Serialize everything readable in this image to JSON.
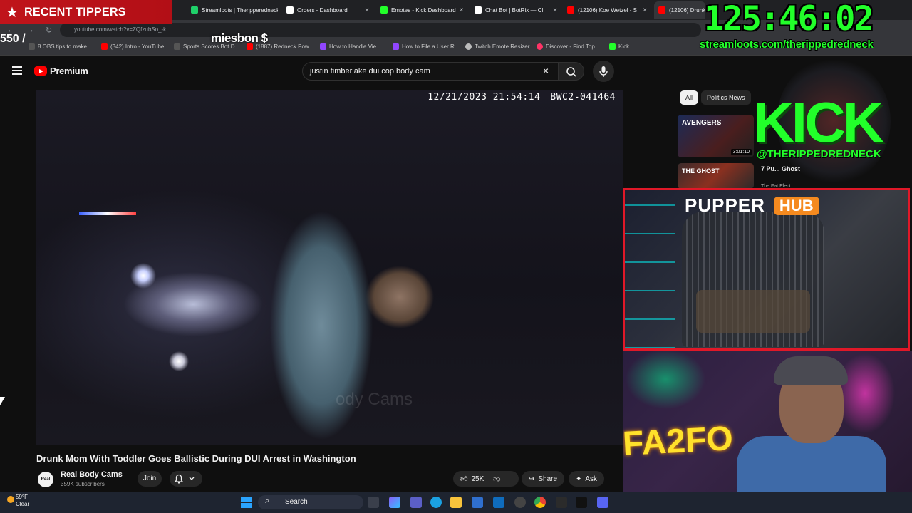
{
  "browser": {
    "tabs": [
      {
        "title": "Streamloots | Theripperedneck",
        "color": "#1fd06a"
      },
      {
        "title": "Orders - Dashboard",
        "color": "#ffffff"
      },
      {
        "title": "Emotes - Kick Dashboard",
        "color": "#22ff2a"
      },
      {
        "title": "Chat Bot | BotRix — Cl",
        "color": "#ffffff"
      },
      {
        "title": "(12106) Koe Wetzel - S",
        "color": "#ff0000"
      },
      {
        "title": "(12106) Drunk",
        "color": "#ff0000"
      }
    ],
    "tab_close": "×",
    "address": "youtube.com/watch?v=ZQfzubSo_-k",
    "bookmarks": [
      {
        "label": "8 OBS tips to make...",
        "color": "#555555"
      },
      {
        "label": "(342) Intro - YouTube",
        "color": "#ff0000"
      },
      {
        "label": "Sports Scores Bot D...",
        "color": "#555555"
      },
      {
        "label": "(1887) Redneck Pow...",
        "color": "#ff0000"
      },
      {
        "label": "How to Handle Vie...",
        "color": "#9146ff"
      },
      {
        "label": "How to File a User R...",
        "color": "#9146ff"
      },
      {
        "label": "Twitch Emote Resizer",
        "color": "#bbbbbb"
      },
      {
        "label": "Discover - Find Top...",
        "color": "#ff3366"
      },
      {
        "label": "Kick",
        "color": "#22ff2a"
      }
    ]
  },
  "overlay": {
    "tippers_title": "RECENT TIPPERS",
    "scroll_user": "miesbon $",
    "scroll_left": "550 /",
    "timer": "125:46:02",
    "streamloots_url": "streamloots.com/therippedredneck",
    "kick_logo": "KICK",
    "kick_handle": "@THERIPPEDREDNECK",
    "pupper_label": "PUPPER",
    "hub_label": "HUB"
  },
  "youtube": {
    "logo_text": "Premium",
    "search_query": "justin timberlake dui cop body cam",
    "clear_icon": "×",
    "video": {
      "timestamp": "12/21/2023 21:54:14",
      "camera_id": "BWC2-041464",
      "watermark": "ody Cams"
    },
    "title": "Drunk Mom With Toddler Goes Ballistic During DUI Arrest in Washington",
    "channel": {
      "avatar_text": "Real",
      "name": "Real Body Cams",
      "subscribers": "359K subscribers"
    },
    "join_label": "Join",
    "likes": "25K",
    "share_label": "Share",
    "ask_label": "Ask",
    "chips": [
      {
        "label": "All",
        "active": true
      },
      {
        "label": "Politics News",
        "active": false
      }
    ],
    "recommendations": [
      {
        "duration": "3:01:10",
        "thumb_text": "AVENGERS",
        "title": "",
        "channel": ""
      },
      {
        "duration": "",
        "thumb_text": "THE GHOST",
        "title": "7 Pu... Ghost",
        "channel": "The Fat Elect..."
      }
    ]
  },
  "taskbar": {
    "temperature": "59°F",
    "condition": "Clear",
    "search_label": "Search"
  }
}
